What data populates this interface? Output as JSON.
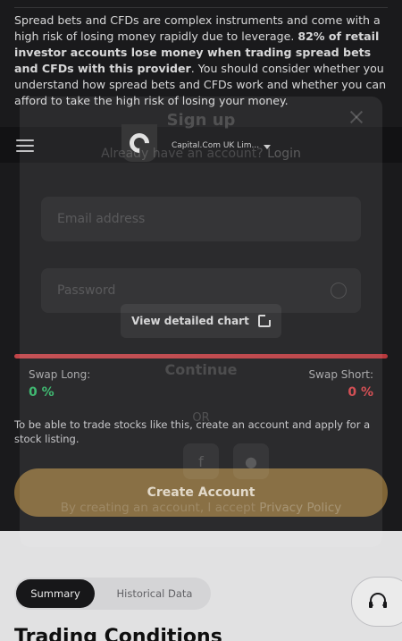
{
  "risk_warning": {
    "part1": "Spread bets and CFDs are complex instruments and come with a high risk of losing money rapidly due to leverage. ",
    "bold": "82% of retail investor accounts lose money when trading spread bets and CFDs with this provider",
    "part2": ". You should consider whether you understand how spread bets and CFDs work and whether you can afford to take the high risk of losing your money."
  },
  "header": {
    "entity_label": "Capital.Com UK Lim..."
  },
  "chart": {
    "view_detailed_label": "View detailed chart"
  },
  "swap": {
    "long_label": "Swap Long:",
    "long_value": "0 %",
    "short_label": "Swap Short:",
    "short_value": "0 %"
  },
  "note": "To be able to trade stocks like this, create an account and apply for a stock listing.",
  "create_account_label": "Create Account",
  "tabs": [
    {
      "label": "Summary",
      "active": true
    },
    {
      "label": "Historical Data",
      "active": false
    }
  ],
  "section_title": "Trading Conditions",
  "modal": {
    "title": "Sign up",
    "already_text": "Already have an account?",
    "login_link": "Login",
    "email_placeholder": "Email address",
    "password_placeholder": "Password",
    "continue_label": "Continue",
    "or_label": "OR",
    "terms_text": "By creating an account, I accept",
    "privacy_link": "Privacy Policy"
  },
  "colors": {
    "swap_bar": "#d14a4f",
    "swap_long": "#35c46f",
    "swap_short": "#e3484e",
    "create_button": "#8a6d3b"
  },
  "icons": [
    "menu-icon",
    "logo-icon",
    "caret-down-icon",
    "external-link-icon",
    "close-icon",
    "eye-icon",
    "facebook-icon",
    "apple-icon",
    "headset-icon"
  ]
}
